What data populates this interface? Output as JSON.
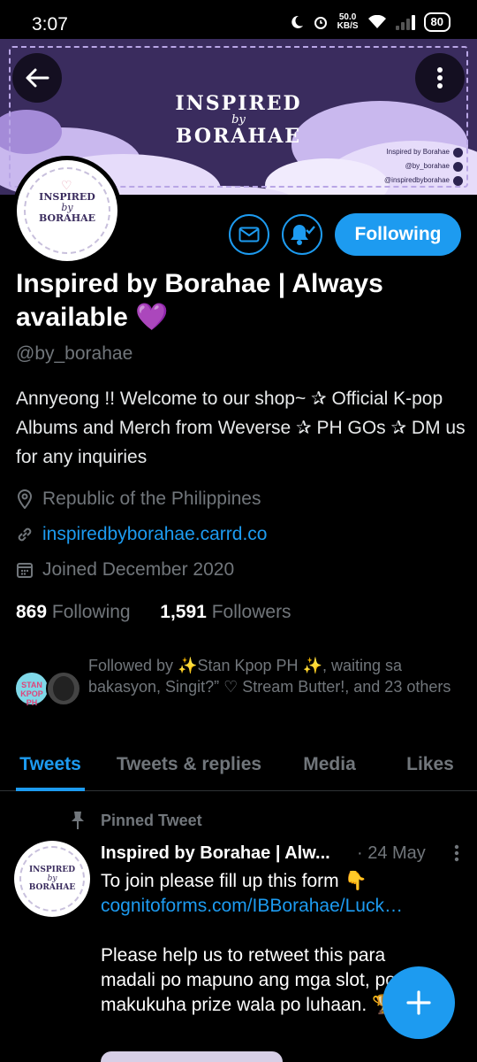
{
  "status_bar": {
    "time": "3:07",
    "speed_value": "50.0",
    "speed_unit": "KB/S",
    "battery": "80"
  },
  "banner": {
    "logo_line1": "INSPIRED",
    "logo_line2": "by",
    "logo_line3": "BORAHAE",
    "socials": [
      "Inspired by Borahae",
      "@by_borahae",
      "@inspiredbyborahae"
    ]
  },
  "avatar": {
    "line1": "INSPIRED",
    "line2": "by",
    "line3": "BORAHAE"
  },
  "actions": {
    "following_label": "Following"
  },
  "profile": {
    "name": "Inspired by Borahae | Always available",
    "name_emoji": "💜",
    "handle": "@by_borahae",
    "bio": "Annyeong !! Welcome to our shop~  ✰ Official K-pop Albums and Merch from Weverse ✰ PH GOs ✰ DM us for any inquiries",
    "location": "Republic of the Philippines",
    "website": "inspiredbyborahae.carrd.co",
    "joined": "Joined December 2020",
    "following_count": "869",
    "following_label": "Following",
    "followers_count": "1,591",
    "followers_label": "Followers",
    "followed_by": "Followed by ✨Stan Kpop PH ✨, waiting sa bakasyon, Singit?” ♡ Stream Butter!, and 23 others",
    "followed_avatar1_text": "STAN KPOP PH"
  },
  "tabs": [
    "Tweets",
    "Tweets & replies",
    "Media",
    "Likes"
  ],
  "pinned_tweet": {
    "pinned_label": "Pinned Tweet",
    "author": "Inspired by Borahae | Alw...",
    "date": "· 24 May",
    "line1": "To join please fill up this form 👇",
    "link": "cognitoforms.com/IBBorahae/Luck…",
    "line2": "Please help us to retweet this para madali po mapuno ang mga slot, po may makukuha prize wala po luhaan. 🏆💜"
  },
  "colors": {
    "accent": "#1d9bf0",
    "banner": "#3a2c5e",
    "background": "#000000",
    "muted": "#71767b"
  }
}
